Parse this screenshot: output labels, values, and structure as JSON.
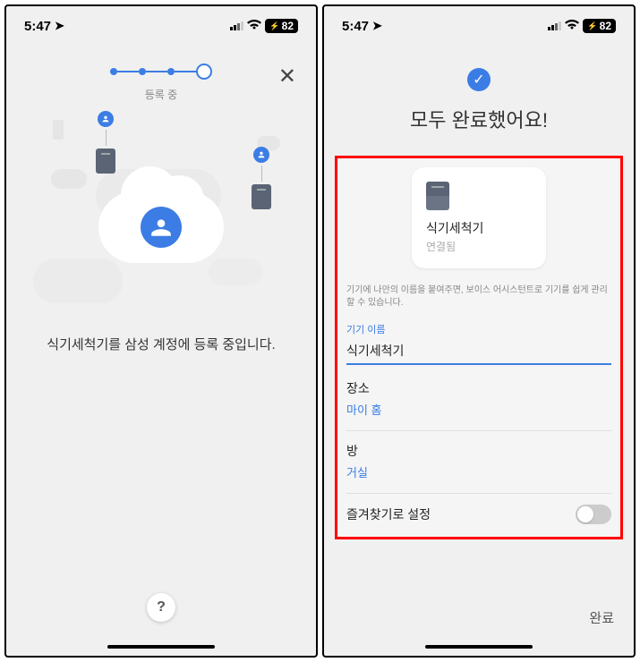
{
  "statusbar": {
    "time": "5:47",
    "battery": "82"
  },
  "left": {
    "progress_label": "등록 중",
    "message": "식기세척기를 삼성 계정에 등록 중입니다.",
    "help": "?"
  },
  "right": {
    "title": "모두 완료했어요!",
    "device": {
      "name": "식기세척기",
      "status": "연결됨"
    },
    "helper": "기기에 나만의 이름을 붙여주면, 보이스 어시스턴트로 기기를 쉽게 관리할 수 있습니다.",
    "name_field": {
      "label": "기기 이름",
      "value": "식기세척기"
    },
    "location": {
      "label": "장소",
      "value": "마이 홈"
    },
    "room": {
      "label": "방",
      "value": "거실"
    },
    "favorite_label": "즐겨찾기로 설정",
    "done": "완료"
  }
}
